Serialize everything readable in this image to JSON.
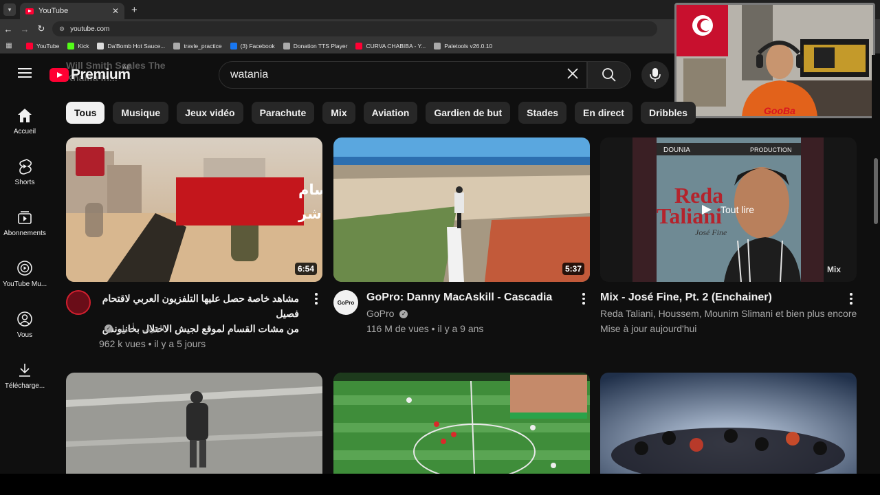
{
  "browser": {
    "tab_title": "YouTube",
    "url": "youtube.com",
    "bookmarks": [
      {
        "label": "YouTube",
        "icon": "youtube-icon",
        "color": "#ff0033"
      },
      {
        "label": "Kick",
        "icon": "kick-icon",
        "color": "#53fc18"
      },
      {
        "label": "Da'Bomb Hot Sauce...",
        "icon": "page-icon",
        "color": "#dddddd"
      },
      {
        "label": "travle_practice",
        "icon": "compass-icon",
        "color": "#aaaaaa"
      },
      {
        "label": "(3) Facebook",
        "icon": "facebook-icon",
        "color": "#1877f2"
      },
      {
        "label": "Donation TTS Player",
        "icon": "globe-icon",
        "color": "#aaaaaa"
      },
      {
        "label": "CURVA CHABIBA - Y...",
        "icon": "youtube-icon",
        "color": "#ff0033"
      },
      {
        "label": "Paletools v26.0.10",
        "icon": "globe-icon",
        "color": "#aaaaaa"
      }
    ]
  },
  "header": {
    "logo_text": "Premium",
    "region": "AE",
    "search_value": "watania",
    "ghost_text": [
      "Will Smith Scales The",
      "Khalifa In..."
    ]
  },
  "sidebar": [
    {
      "label": "Accueil",
      "icon": "home-icon"
    },
    {
      "label": "Shorts",
      "icon": "shorts-icon"
    },
    {
      "label": "Abonnements",
      "icon": "subscriptions-icon"
    },
    {
      "label": "YouTube Mu...",
      "icon": "youtube-music-icon"
    },
    {
      "label": "Vous",
      "icon": "user-icon"
    },
    {
      "label": "Télécharge...",
      "icon": "download-icon"
    }
  ],
  "chips": [
    "Tous",
    "Musique",
    "Jeux vidéo",
    "Parachute",
    "Mix",
    "Aviation",
    "Gardien de but",
    "Stades",
    "En direct",
    "Dribbles"
  ],
  "videos": [
    {
      "thumb_text": [
        "مقاتلو القسام",
        "في اشتباك مباشر"
      ],
      "duration": "6:54",
      "title_lines": [
        "مشاهد خاصة حصل عليها التلفزيون العربي لاقتحام فصيل",
        "من مشات القسام لموقع لجيش الاحتلال بخانيونس"
      ],
      "channel": "العربي - أخبار",
      "meta": "962 k vues • il y a 5 jours"
    },
    {
      "duration": "5:37",
      "title": "GoPro: Danny MacAskill - Cascadia",
      "channel": "GoPro",
      "meta": "116 M de vues • il y a 9 ans"
    },
    {
      "overlay": "Tout lire",
      "mix_badge": "Mix",
      "cover_text": [
        "DOUNIA",
        "PRODUCTION",
        "Reda",
        "Taliani",
        "José Fine"
      ],
      "title": "Mix - José Fine, Pt. 2 (Enchainer)",
      "channel": "Reda Taliani, Houssem, Mounim Slimani et bien plus encore",
      "meta": "Mise à jour aujourd'hui"
    }
  ],
  "colors": {
    "background": "#0f0f0f",
    "brand_red": "#ff0033",
    "chip_bg": "#272727",
    "secondary_text": "#aaaaaa"
  }
}
